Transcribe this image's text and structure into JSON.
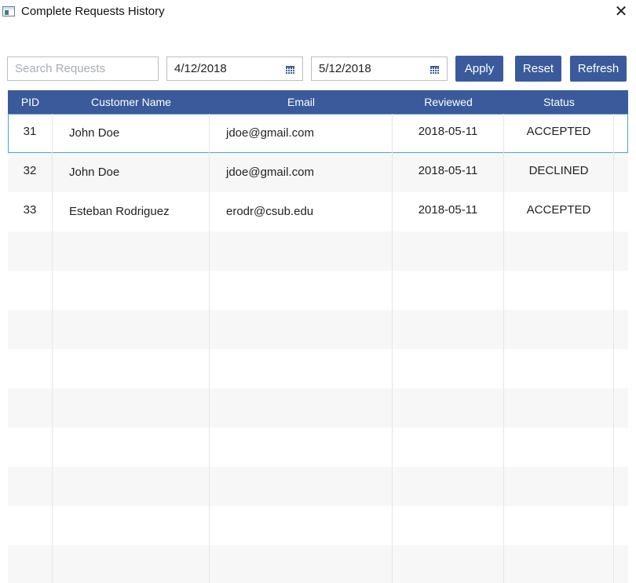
{
  "window": {
    "title": "Complete Requests History",
    "close_glyph": "✕"
  },
  "toolbar": {
    "search_placeholder": "Search Requests",
    "date_from": "4/12/2018",
    "date_to": "5/12/2018",
    "apply_label": "Apply",
    "reset_label": "Reset",
    "refresh_label": "Refresh"
  },
  "table": {
    "columns": [
      "PID",
      "Customer Name",
      "Email",
      "Reviewed",
      "Status"
    ],
    "rows": [
      {
        "pid": "31",
        "name": "John Doe",
        "email": "jdoe@gmail.com",
        "reviewed": "2018-05-11",
        "status": "ACCEPTED"
      },
      {
        "pid": "32",
        "name": "John Doe",
        "email": "jdoe@gmail.com",
        "reviewed": "2018-05-11",
        "status": "DECLINED"
      },
      {
        "pid": "33",
        "name": "Esteban Rodriguez",
        "email": "erodr@csub.edu",
        "reviewed": "2018-05-11",
        "status": "ACCEPTED"
      }
    ]
  },
  "colors": {
    "accent": "#3a5a9b",
    "selection_border": "#4aa6cf",
    "alt_row": "#f7f7f7"
  }
}
